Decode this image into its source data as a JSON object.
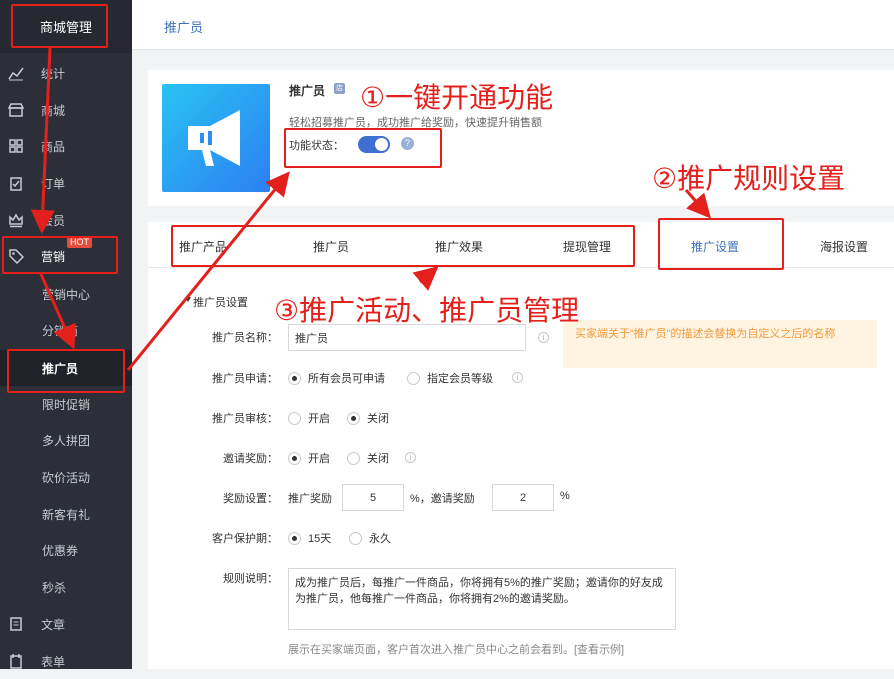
{
  "sidebar": {
    "brand": "商城管理",
    "items": [
      {
        "label": "统计",
        "icon": "chart-icon"
      },
      {
        "label": "商城",
        "icon": "store-icon"
      },
      {
        "label": "商品",
        "icon": "grid-icon"
      },
      {
        "label": "订单",
        "icon": "clipboard-icon"
      },
      {
        "label": "会员",
        "icon": "crown-icon"
      },
      {
        "label": "营销",
        "icon": "tag-icon"
      }
    ],
    "hot_badge": "HOT",
    "sub_items": [
      "营销中心",
      "分销商",
      "推广员",
      "限时促销",
      "多人拼团",
      "砍价活动",
      "新客有礼",
      "优惠券",
      "秒杀"
    ],
    "bottom_items": [
      {
        "label": "文章",
        "icon": "document-icon"
      },
      {
        "label": "表单",
        "icon": "form-icon"
      }
    ]
  },
  "breadcrumb": "推广员",
  "feature": {
    "title": "推广员",
    "title_badge": "店",
    "description": "轻松招募推广员，成功推广给奖励，快速提升销售额",
    "status_label": "功能状态：",
    "status_on": true,
    "help_icon": "?"
  },
  "tabs": [
    "推广产品",
    "推广员",
    "推广效果",
    "提现管理",
    "推广设置",
    "海报设置"
  ],
  "active_tab": "推广设置",
  "settings": {
    "section_title": "推广员设置",
    "name_label": "推广员名称：",
    "name_value": "推广员",
    "tip": "买家端关于“推广员”的描述会替换为自定义之后的名称",
    "apply_label": "推广员申请：",
    "apply_options": [
      "所有会员可申请",
      "指定会员等级"
    ],
    "review_label": "推广员审核：",
    "review_options": [
      "开启",
      "关闭"
    ],
    "invite_label": "邀请奖励：",
    "invite_options": [
      "开启",
      "关闭"
    ],
    "reward_label": "奖励设置：",
    "reward_promote_label": "推广奖励",
    "reward_promote_value": "5",
    "reward_invite_label": "%，邀请奖励",
    "reward_invite_value": "2",
    "percent": "%",
    "protect_label": "客户保护期：",
    "protect_options": [
      "15天",
      "永久"
    ],
    "rules_label": "规则说明：",
    "rules_text": "成为推广员后，每推广一件商品，你将拥有5%的推广奖励；邀请你的好友成为推广员，他每推广一件商品，你将拥有2%的邀请奖励。",
    "rules_note": "展示在买家端页面，客户首次进入推广员中心之前会看到。[查看示例]"
  },
  "annotations": {
    "step1": "①一键开通功能",
    "step2": "②推广规则设置",
    "step3": "③推广活动、推广员管理",
    "color": "#e3201b"
  }
}
